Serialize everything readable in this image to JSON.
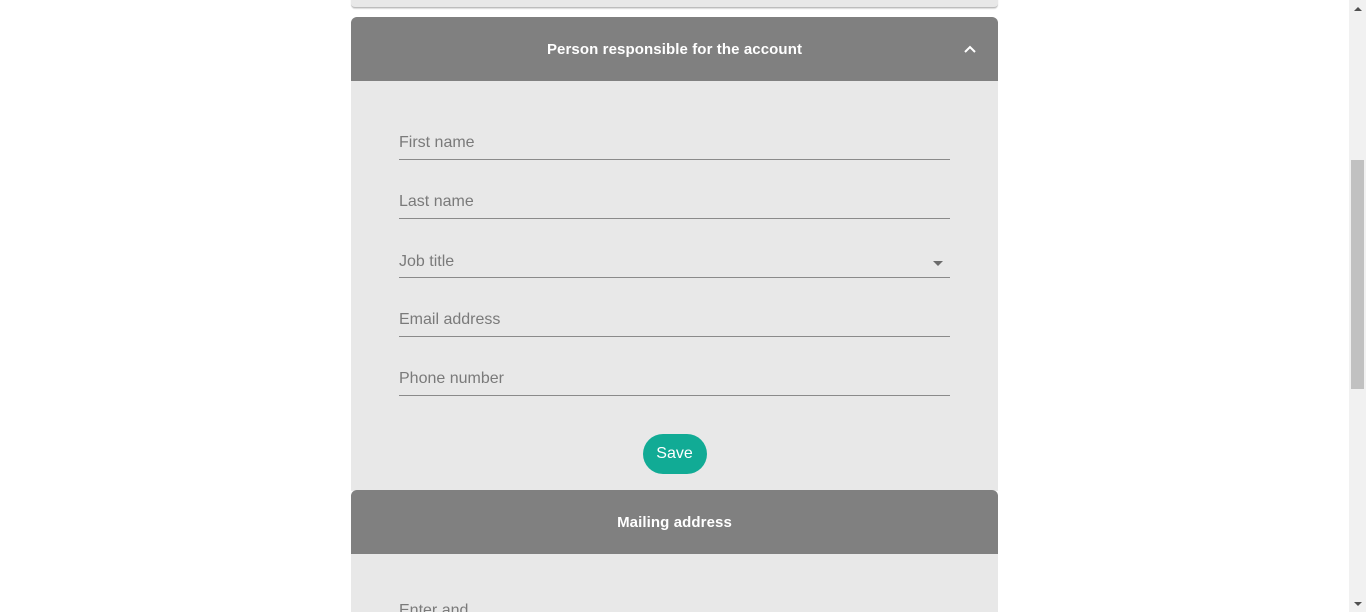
{
  "person_section": {
    "title": "Person responsible for the account",
    "fields": {
      "first_name_placeholder": "First name",
      "last_name_placeholder": "Last name",
      "job_title_label": "Job title",
      "email_placeholder": "Email address",
      "phone_placeholder": "Phone number"
    },
    "save_label": "Save",
    "collapse_icon": "chevron-up-icon"
  },
  "mailing_section": {
    "title": "Mailing address",
    "first_field_placeholder": "Enter and..."
  },
  "colors": {
    "header_bg": "#808080",
    "card_bg": "#e8e8e8",
    "accent": "#11ab95"
  }
}
